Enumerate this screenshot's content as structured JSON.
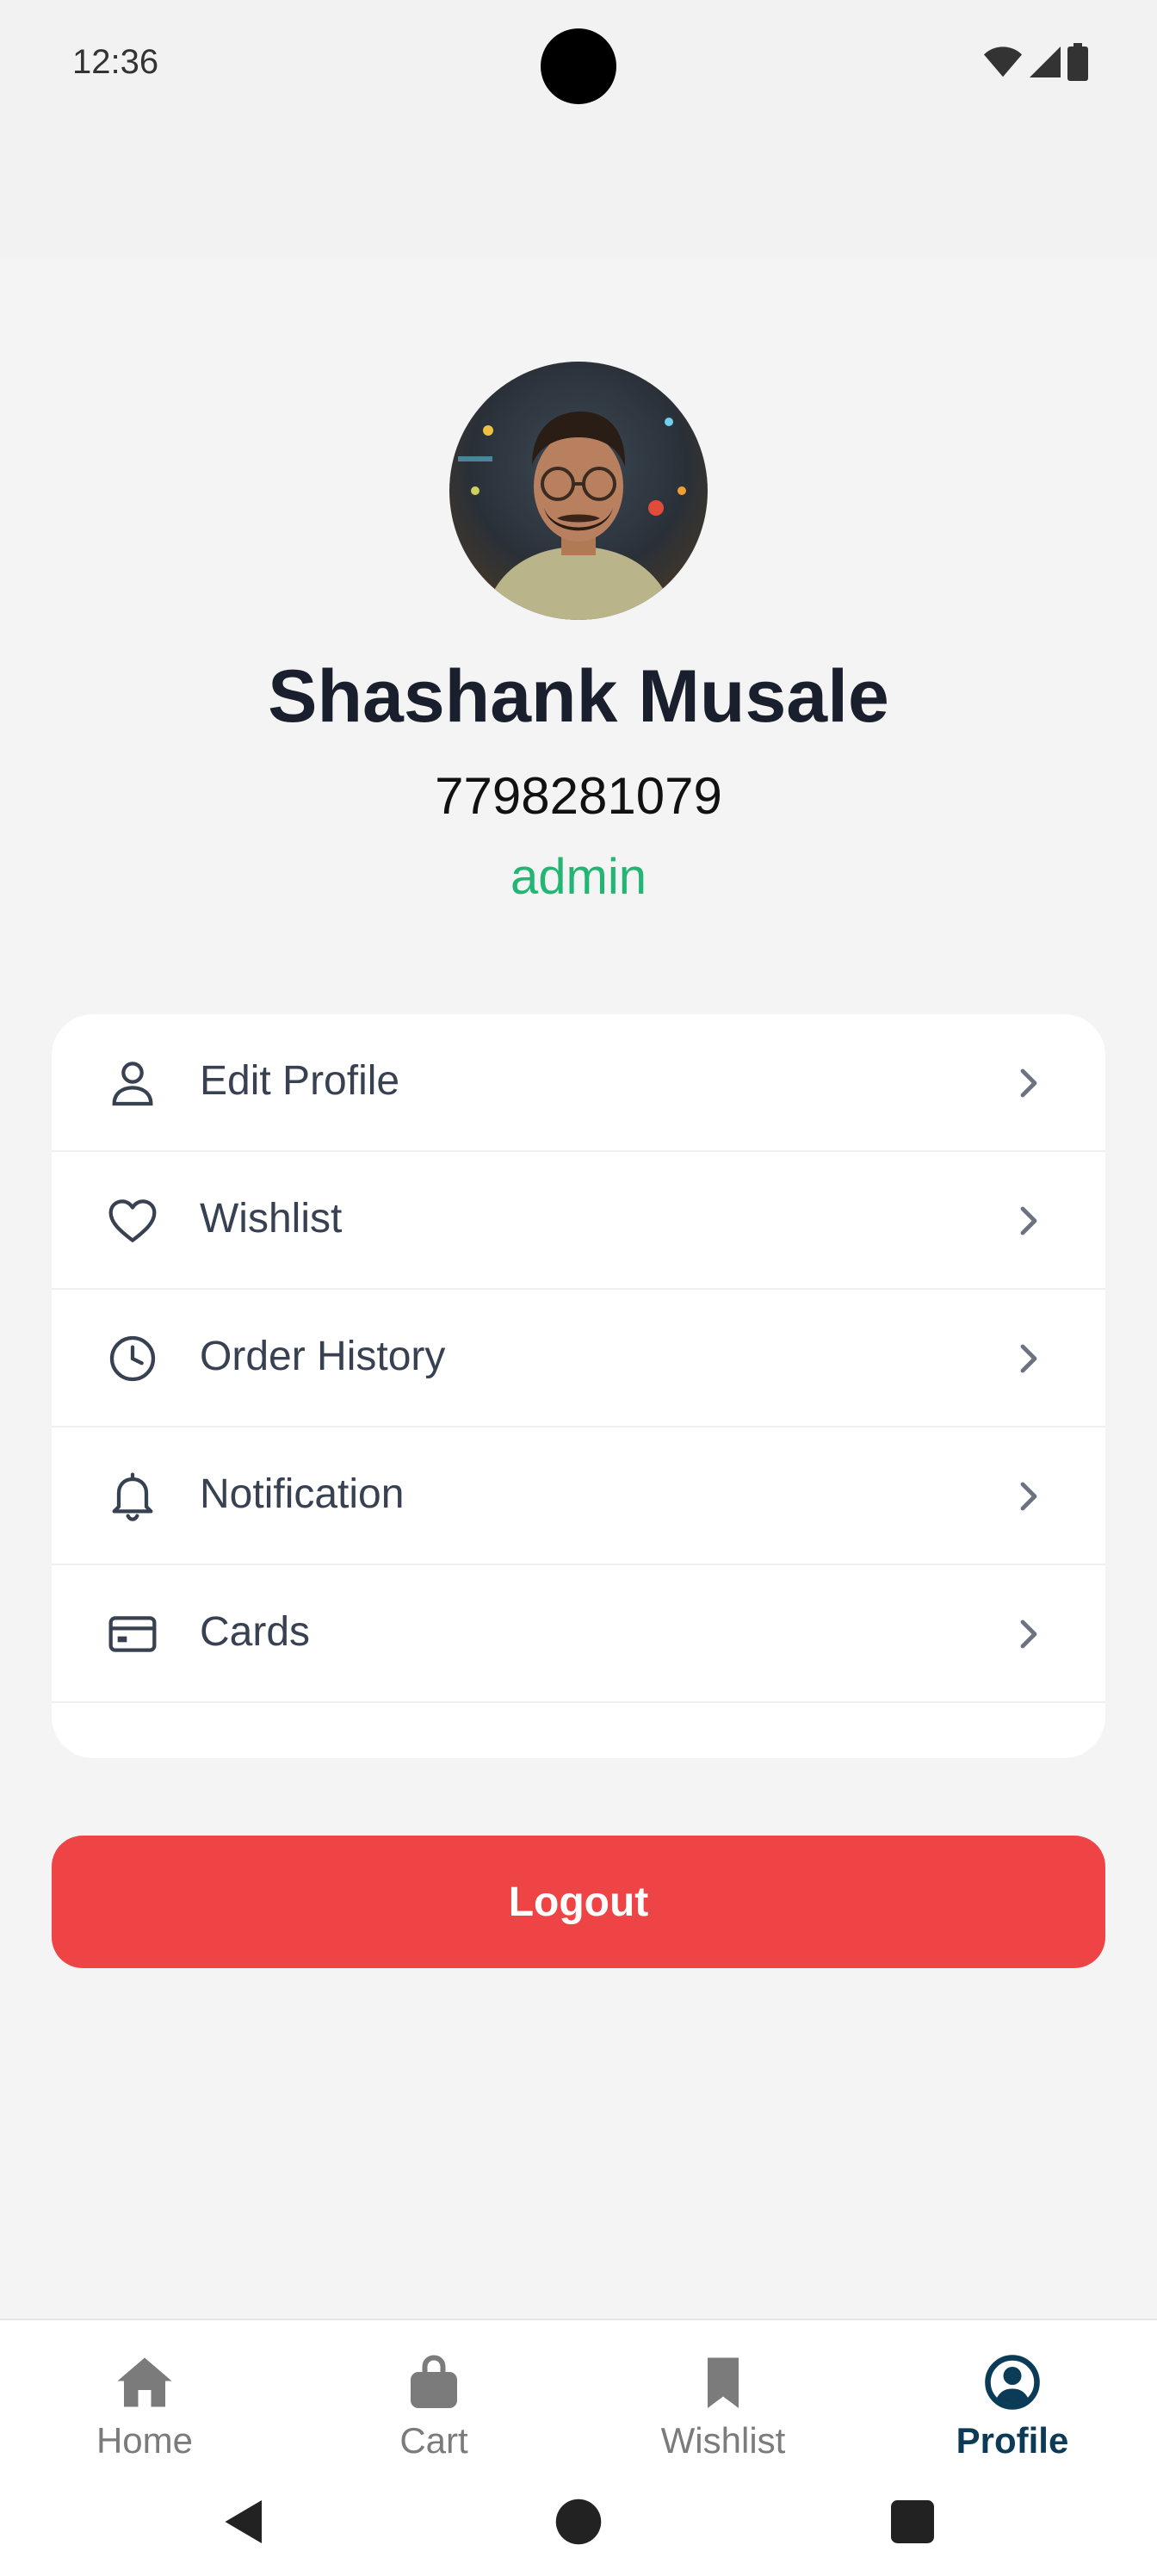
{
  "status_bar": {
    "time": "12:36"
  },
  "profile": {
    "name": "Shashank Musale",
    "phone": "7798281079",
    "role": "admin"
  },
  "menu": {
    "items": [
      {
        "label": "Edit Profile",
        "icon": "person-icon"
      },
      {
        "label": "Wishlist",
        "icon": "heart-icon"
      },
      {
        "label": "Order History",
        "icon": "clock-icon"
      },
      {
        "label": "Notification",
        "icon": "bell-icon"
      },
      {
        "label": "Cards",
        "icon": "card-icon"
      }
    ]
  },
  "logout": {
    "label": "Logout"
  },
  "bottom_nav": {
    "items": [
      {
        "label": "Home",
        "icon": "home-icon"
      },
      {
        "label": "Cart",
        "icon": "shopping-bag-icon"
      },
      {
        "label": "Wishlist",
        "icon": "bookmark-icon"
      },
      {
        "label": "Profile",
        "icon": "account-circle-icon"
      }
    ],
    "active": "Profile"
  },
  "colors": {
    "role": "#22b573",
    "logout": "#ef4446",
    "nav_active": "#0b3b57",
    "nav_inactive": "#7b7b7b"
  }
}
